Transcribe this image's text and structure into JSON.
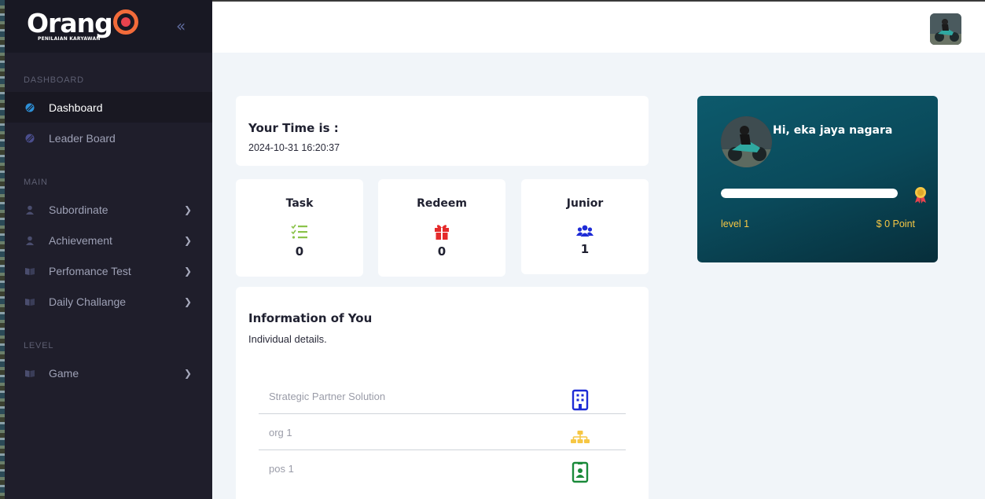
{
  "brand": {
    "name": "Orang",
    "tagline": "PENILAIAN KARYAWAN"
  },
  "colors": {
    "sidebar_bg": "#1f1e2b",
    "accent_orange": "#f26b3a",
    "gold": "#f6c744",
    "teal_card": "#0a4a5b"
  },
  "sidebar": {
    "sections": [
      {
        "label": "DASHBOARD"
      },
      {
        "label": "MAIN"
      },
      {
        "label": "LEVEL"
      }
    ],
    "items": [
      {
        "label": "Dashboard",
        "icon": "dashboard-icon",
        "active": true
      },
      {
        "label": "Leader Board",
        "icon": "leaderboard-icon"
      },
      {
        "label": "Subordinate",
        "icon": "user-icon",
        "chevron": true
      },
      {
        "label": "Achievement",
        "icon": "user-icon",
        "chevron": true
      },
      {
        "label": "Perfomance Test",
        "icon": "book-icon",
        "chevron": true
      },
      {
        "label": "Daily Challange",
        "icon": "book-icon",
        "chevron": true
      },
      {
        "label": "Game",
        "icon": "book-icon",
        "chevron": true
      }
    ]
  },
  "time_card": {
    "title": "Your Time is :",
    "value": "2024-10-31 16:20:37"
  },
  "stats": [
    {
      "title": "Task",
      "value": "0",
      "icon": "checklist-icon",
      "color": "#8bc34a"
    },
    {
      "title": "Redeem",
      "value": "0",
      "icon": "gift-icon",
      "color": "#e52b2b"
    },
    {
      "title": "Junior",
      "value": "1",
      "icon": "users-icon",
      "color": "#1e2bd6"
    }
  ],
  "info": {
    "title": "Information of You",
    "subtitle": "Individual details.",
    "rows": [
      {
        "text": "Strategic Partner Solution",
        "icon": "building-icon",
        "color": "#1e2bd6"
      },
      {
        "text": "org 1",
        "icon": "org-chart-icon",
        "color": "#f6c744"
      },
      {
        "text": "pos 1",
        "icon": "id-badge-icon",
        "color": "#1a8a3a"
      }
    ]
  },
  "profile": {
    "greeting": "Hi, eka jaya nagara",
    "progress_fraction": 1.0,
    "level": "level 1",
    "points": "$ 0 Point"
  }
}
